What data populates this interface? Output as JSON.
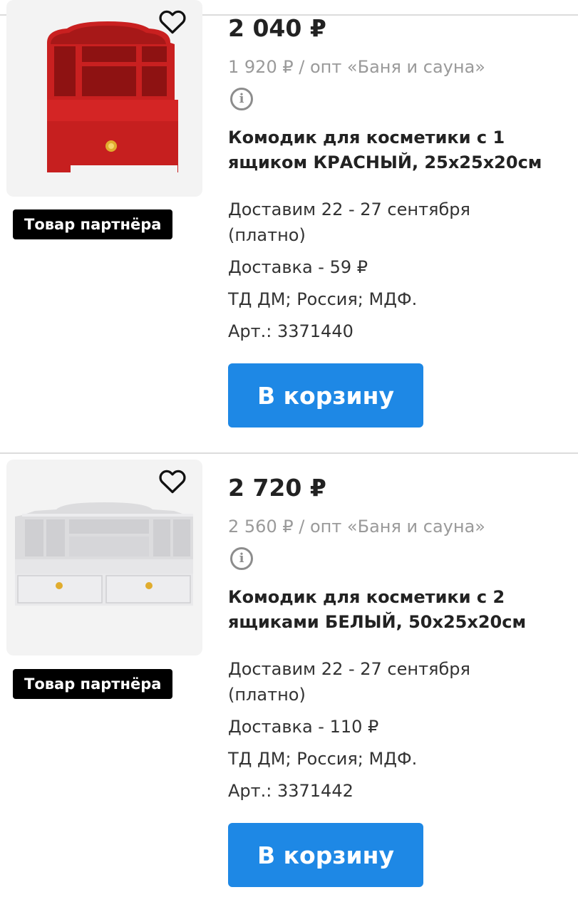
{
  "products": [
    {
      "price": "2 040 ₽",
      "wholesale": "1 920 ₽ / опт «Баня и сауна»",
      "title": "Комодик для косметики с 1 ящиком КРАСНЫЙ, 25x25x20см",
      "delivery_date": "Доставим 22 - 27 сентября",
      "delivery_paid": "(платно)",
      "delivery_cost": "Доставка - 59 ₽",
      "specs": "ТД ДМ; Россия; МДФ.",
      "article": "Арт.: 3371440",
      "badge": "Товар партнёра",
      "cart_label": "В корзину",
      "image": "red-cosmetic-organizer",
      "color": "#d32020"
    },
    {
      "price": "2 720 ₽",
      "wholesale": "2 560 ₽ / опт «Баня и сауна»",
      "title": "Комодик для косметики с 2 ящиками БЕЛЫЙ, 50x25x20см",
      "delivery_date": "Доставим 22 - 27 сентября",
      "delivery_paid": "(платно)",
      "delivery_cost": "Доставка - 110 ₽",
      "specs": "ТД ДМ; Россия; МДФ.",
      "article": "Арт.: 3371442",
      "badge": "Товар партнёра",
      "cart_label": "В корзину",
      "image": "white-cosmetic-organizer",
      "color": "#e9e9ea"
    }
  ],
  "icons": {
    "favorite": "heart-outline-icon",
    "info": "info-circle-icon"
  },
  "colors": {
    "button": "#1e88e5",
    "badge": "#000000",
    "muted": "#9a9a9a"
  }
}
